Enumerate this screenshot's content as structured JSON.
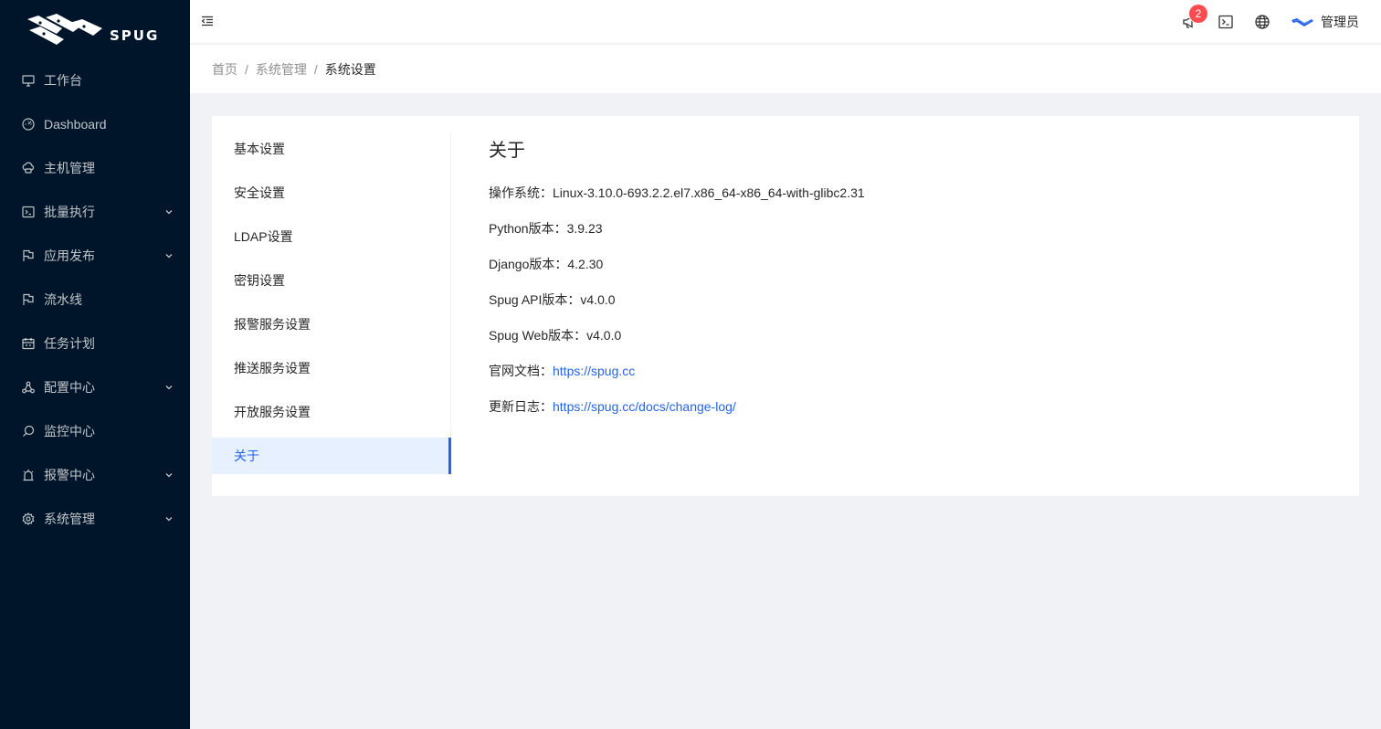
{
  "app": {
    "brand": "SPUG"
  },
  "sidebar": {
    "items": [
      {
        "label": "工作台",
        "icon": "desktop-icon",
        "expandable": false
      },
      {
        "label": "Dashboard",
        "icon": "dashboard-icon",
        "expandable": false
      },
      {
        "label": "主机管理",
        "icon": "cloud-server-icon",
        "expandable": false
      },
      {
        "label": "批量执行",
        "icon": "code-icon",
        "expandable": true
      },
      {
        "label": "应用发布",
        "icon": "flag-icon",
        "expandable": true
      },
      {
        "label": "流水线",
        "icon": "flag-icon",
        "expandable": false
      },
      {
        "label": "任务计划",
        "icon": "schedule-icon",
        "expandable": false
      },
      {
        "label": "配置中心",
        "icon": "deployment-unit-icon",
        "expandable": true
      },
      {
        "label": "监控中心",
        "icon": "monitor-icon",
        "expandable": false
      },
      {
        "label": "报警中心",
        "icon": "alert-icon",
        "expandable": true
      },
      {
        "label": "系统管理",
        "icon": "setting-icon",
        "expandable": true
      }
    ]
  },
  "header": {
    "notifications_count": "2",
    "user_name": "管理员"
  },
  "breadcrumb": [
    "首页",
    "系统管理",
    "系统设置"
  ],
  "settings_nav": {
    "items": [
      "基本设置",
      "安全设置",
      "LDAP设置",
      "密钥设置",
      "报警服务设置",
      "推送服务设置",
      "开放服务设置",
      "关于"
    ],
    "active_index": 7
  },
  "about": {
    "title": "关于",
    "os_label": "操作系统：",
    "os_value": "Linux-3.10.0-693.2.2.el7.x86_64-x86_64-with-glibc2.31",
    "python_label": "Python版本：",
    "python_value": "3.9.23",
    "django_label": "Django版本：",
    "django_value": "4.2.30",
    "api_label": "Spug API版本：",
    "api_value": "v4.0.0",
    "web_label": "Spug Web版本：",
    "web_value": "v4.0.0",
    "docs_label": "官网文档：",
    "docs_link": "https://spug.cc",
    "changelog_label": "更新日志：",
    "changelog_link": "https://spug.cc/docs/change-log/"
  },
  "colors": {
    "sidebar_bg": "#001529",
    "accent": "#2563eb",
    "badge": "#ff4d4f",
    "page_bg": "#f0f2f5"
  }
}
